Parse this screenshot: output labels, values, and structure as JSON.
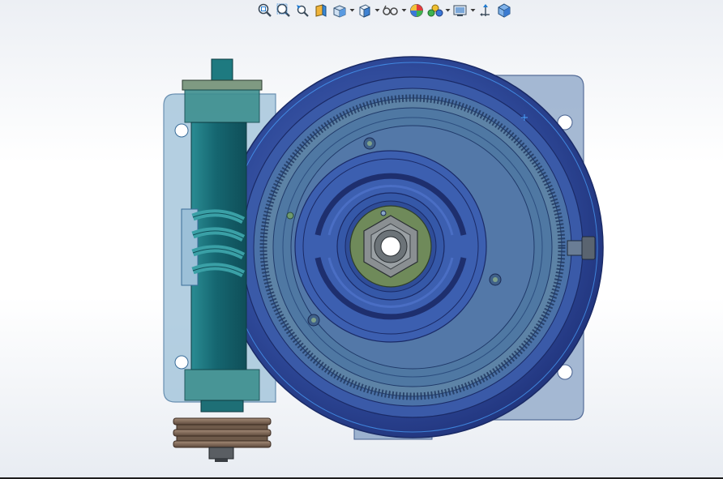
{
  "toolbar": {
    "items": [
      {
        "icon": "zoom-to-fit-icon",
        "dropdown": false
      },
      {
        "icon": "zoom-to-area-icon",
        "dropdown": false
      },
      {
        "icon": "previous-view-icon",
        "dropdown": false
      },
      {
        "icon": "section-view-icon",
        "dropdown": false
      },
      {
        "icon": "view-orientation-icon",
        "dropdown": true
      },
      {
        "icon": "display-style-icon",
        "dropdown": true
      },
      {
        "icon": "hide-show-items-icon",
        "dropdown": true
      },
      {
        "icon": "edit-appearance-icon",
        "dropdown": false
      },
      {
        "icon": "apply-scene-icon",
        "dropdown": true
      },
      {
        "icon": "view-settings-icon",
        "dropdown": true
      },
      {
        "icon": "rotate-view-icon",
        "dropdown": false
      },
      {
        "icon": "3d-view-icon",
        "dropdown": false
      }
    ]
  },
  "colors": {
    "housing_blue": "#2f4a9a",
    "housing_dark": "#1f3178",
    "plate_blue": "#8fa8c8",
    "shaft_teal": "#1a6f7a",
    "worm_teal": "#2f8f95",
    "pulley_brown": "#8a7160",
    "hub_green": "#6f8a5a",
    "selection_blue": "#4aa3ff"
  }
}
